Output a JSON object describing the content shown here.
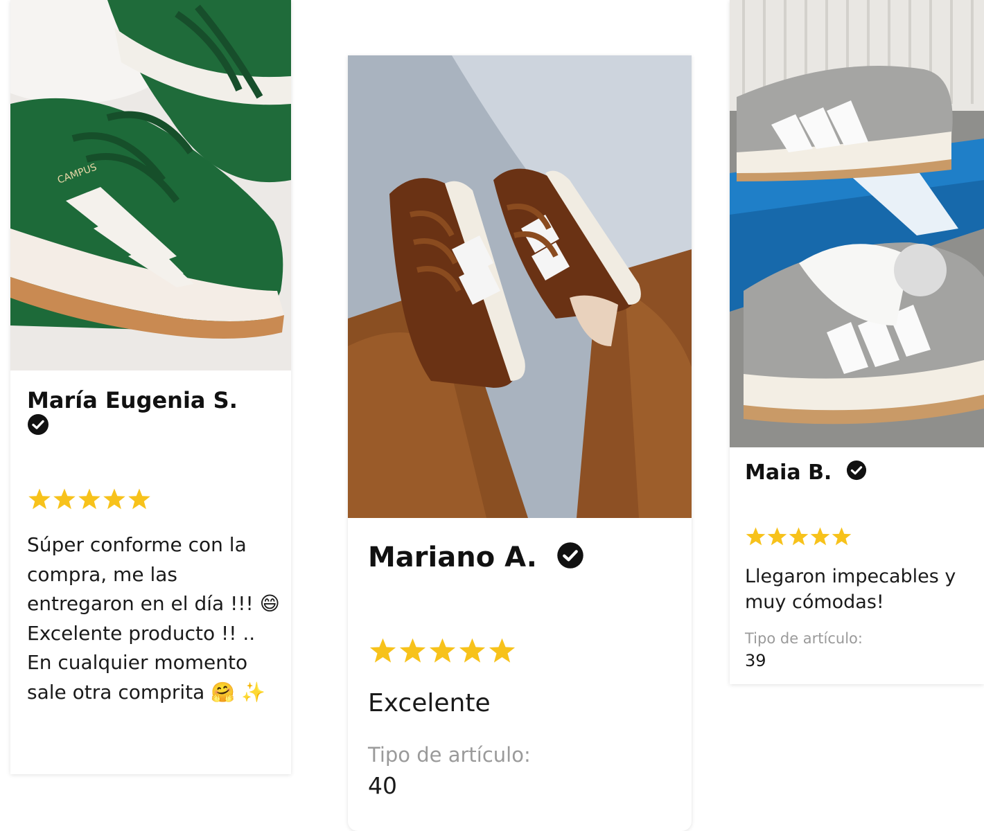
{
  "reviews": [
    {
      "name": "María Eugenia S.",
      "rating": 5,
      "text": "Súper conforme con la compra, me las entregaron en el día !!! 😄\nExcelente producto !! .. En cualquier momento sale otra comprita 🤗 ✨",
      "photo_icon": "green-sneakers-photo"
    },
    {
      "name": "Mariano A.",
      "rating": 5,
      "text": "Excelente",
      "type_label": "Tipo de artículo:",
      "type_value": "40",
      "photo_icon": "brown-sneakers-photo"
    },
    {
      "name": "Maia B.",
      "rating": 5,
      "text": "Llegaron impecables y muy cómodas!",
      "type_label": "Tipo de artículo:",
      "type_value": "39",
      "photo_icon": "grey-sneakers-photo"
    }
  ],
  "colors": {
    "star": "#f7c21b",
    "verified": "#111111",
    "label_gray": "#9a9a9a"
  }
}
